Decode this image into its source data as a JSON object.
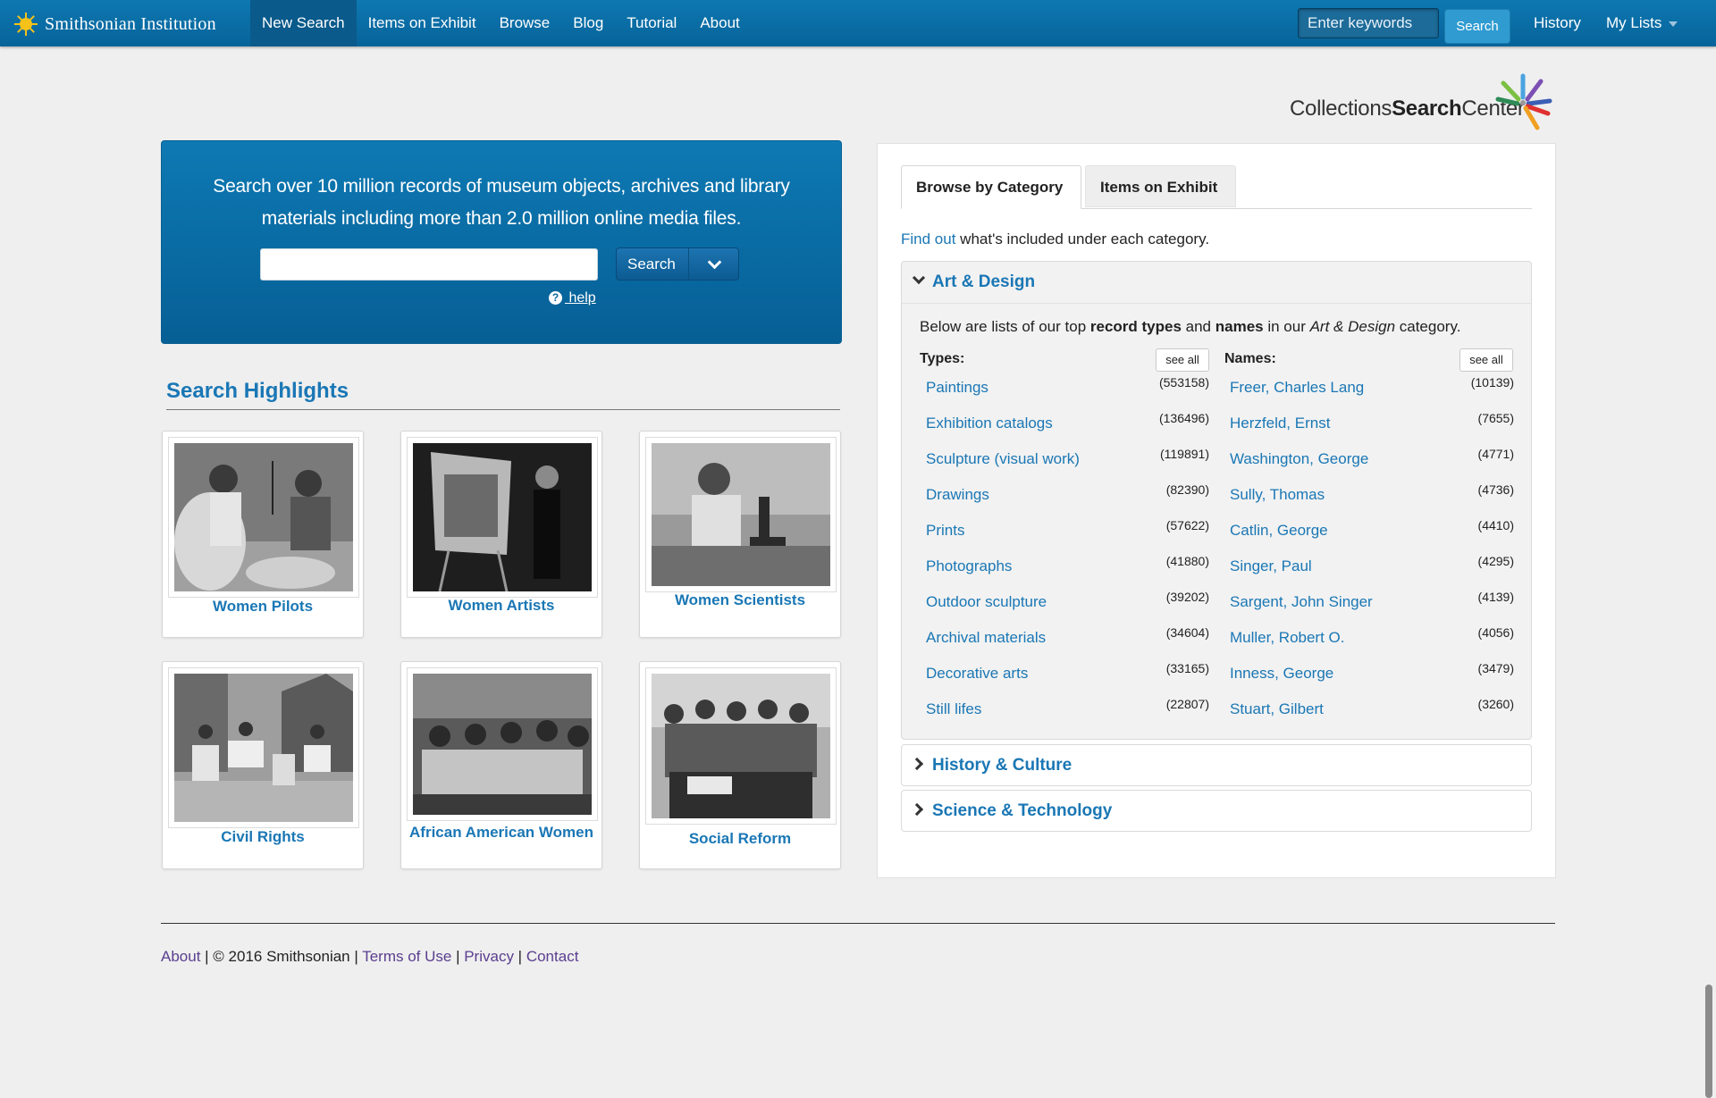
{
  "brand": {
    "name": "Smithsonian Institution"
  },
  "nav": {
    "items": [
      "New Search",
      "Items on Exhibit",
      "Browse",
      "Blog",
      "Tutorial",
      "About"
    ],
    "search_placeholder": "Enter keywords",
    "search_label": "Search",
    "history": "History",
    "my_lists": "My Lists"
  },
  "logo": {
    "part1": "Collections",
    "part2": "Search",
    "part3": "Center"
  },
  "hero": {
    "line1": "Search over 10 million records of museum objects, archives and library",
    "line2": "materials including more than 2.0 million online media files.",
    "search_button": "Search",
    "help": " help"
  },
  "highlights": {
    "title": "Search Highlights",
    "cards": [
      {
        "label": "Women Pilots"
      },
      {
        "label": "Women Artists"
      },
      {
        "label": "Women Scientists"
      },
      {
        "label": "Civil Rights"
      },
      {
        "label": "African American Women"
      },
      {
        "label": "Social Reform"
      }
    ]
  },
  "panel": {
    "tabs": [
      "Browse by Category",
      "Items on Exhibit"
    ],
    "findout_link": "Find out",
    "findout_rest": " what's included under each category.",
    "categories": [
      {
        "title": "Art & Design",
        "desc_1": "Below are lists of our top ",
        "desc_2": "record types",
        "desc_3": " and ",
        "desc_4": "names",
        "desc_5": " in our ",
        "desc_6": "Art & Design",
        "desc_7": " category.",
        "types_label": "Types:",
        "names_label": "Names:",
        "see_all": "see all",
        "types": [
          {
            "name": "Paintings",
            "count": "(553158)"
          },
          {
            "name": "Exhibition catalogs",
            "count": "(136496)"
          },
          {
            "name": "Sculpture (visual work)",
            "count": "(119891)"
          },
          {
            "name": "Drawings",
            "count": "(82390)"
          },
          {
            "name": "Prints",
            "count": "(57622)"
          },
          {
            "name": "Photographs",
            "count": "(41880)"
          },
          {
            "name": "Outdoor sculpture",
            "count": "(39202)"
          },
          {
            "name": "Archival materials",
            "count": "(34604)"
          },
          {
            "name": "Decorative arts",
            "count": "(33165)"
          },
          {
            "name": "Still lifes",
            "count": "(22807)"
          }
        ],
        "names": [
          {
            "name": "Freer, Charles Lang",
            "count": "(10139)"
          },
          {
            "name": "Herzfeld, Ernst",
            "count": "(7655)"
          },
          {
            "name": "Washington, George",
            "count": "(4771)"
          },
          {
            "name": "Sully, Thomas",
            "count": "(4736)"
          },
          {
            "name": "Catlin, George",
            "count": "(4410)"
          },
          {
            "name": "Singer, Paul",
            "count": "(4295)"
          },
          {
            "name": "Sargent, John Singer",
            "count": "(4139)"
          },
          {
            "name": "Muller, Robert O.",
            "count": "(4056)"
          },
          {
            "name": "Inness, George",
            "count": "(3479)"
          },
          {
            "name": "Stuart, Gilbert",
            "count": "(3260)"
          }
        ]
      },
      {
        "title": "History & Culture"
      },
      {
        "title": "Science & Technology"
      }
    ]
  },
  "footer": {
    "about": "About",
    "copyright": " | © 2016 Smithsonian | ",
    "terms": "Terms of Use",
    "sep1": " | ",
    "privacy": "Privacy",
    "sep2": " | ",
    "contact": "Contact"
  },
  "colors": {
    "nav_bg": "#0b6fa8",
    "accent": "#1a77b5",
    "page_bg": "#efefef"
  }
}
